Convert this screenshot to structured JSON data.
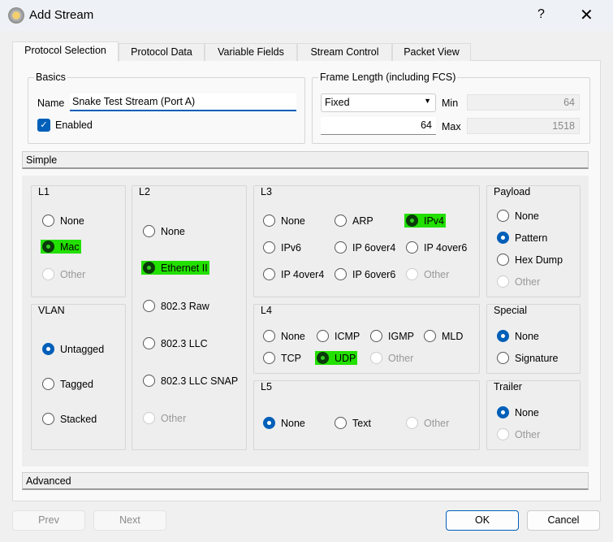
{
  "window": {
    "title": "Add Stream",
    "help": "?",
    "close": "✕"
  },
  "tabs": [
    "Protocol Selection",
    "Protocol Data",
    "Variable Fields",
    "Stream Control",
    "Packet View"
  ],
  "basics": {
    "title": "Basics",
    "name_label": "Name",
    "name_value": "Snake Test Stream (Port A)",
    "enabled_label": "Enabled",
    "enabled": true
  },
  "frame": {
    "title": "Frame Length (including FCS)",
    "mode": "Fixed",
    "value": "64",
    "min_label": "Min",
    "min": "64",
    "max_label": "Max",
    "max": "1518"
  },
  "sections": {
    "simple": "Simple",
    "advanced": "Advanced"
  },
  "groups": [
    {
      "title": "L1",
      "options": [
        {
          "label": "None"
        },
        {
          "label": "Mac",
          "selected": true,
          "highlighted": true
        },
        {
          "label": "Other",
          "disabled": true
        }
      ]
    },
    {
      "title": "VLAN",
      "options": [
        {
          "label": "Untagged",
          "selected": true
        },
        {
          "label": "Tagged"
        },
        {
          "label": "Stacked"
        }
      ]
    },
    {
      "title": "L2",
      "options": [
        {
          "label": "None"
        },
        {
          "label": "Ethernet II",
          "selected": true,
          "highlighted": true
        },
        {
          "label": "802.3 Raw"
        },
        {
          "label": "802.3 LLC"
        },
        {
          "label": "802.3 LLC SNAP"
        },
        {
          "label": "Other",
          "disabled": true
        }
      ]
    },
    {
      "title": "L3",
      "options": [
        {
          "label": "None"
        },
        {
          "label": "ARP"
        },
        {
          "label": "IPv4",
          "selected": true,
          "highlighted": true
        },
        {
          "label": "IPv6"
        },
        {
          "label": "IP 6over4"
        },
        {
          "label": "IP 4over6"
        },
        {
          "label": "IP 4over4"
        },
        {
          "label": "IP 6over6"
        },
        {
          "label": "Other",
          "disabled": true
        }
      ]
    },
    {
      "title": "L4",
      "options": [
        {
          "label": "None"
        },
        {
          "label": "ICMP"
        },
        {
          "label": "IGMP"
        },
        {
          "label": "MLD"
        },
        {
          "label": "TCP"
        },
        {
          "label": "UDP",
          "selected": true,
          "highlighted": true
        },
        {
          "label": "Other",
          "disabled": true
        }
      ]
    },
    {
      "title": "L5",
      "options": [
        {
          "label": "None",
          "selected": true
        },
        {
          "label": "Text"
        },
        {
          "label": "Other",
          "disabled": true
        }
      ]
    },
    {
      "title": "Payload",
      "options": [
        {
          "label": "None"
        },
        {
          "label": "Pattern",
          "selected": true
        },
        {
          "label": "Hex Dump"
        },
        {
          "label": "Other",
          "disabled": true
        }
      ]
    },
    {
      "title": "Special",
      "options": [
        {
          "label": "None",
          "selected": true
        },
        {
          "label": "Signature"
        }
      ]
    },
    {
      "title": "Trailer",
      "options": [
        {
          "label": "None",
          "selected": true
        },
        {
          "label": "Other",
          "disabled": true
        }
      ]
    }
  ],
  "buttons": {
    "prev": "Prev",
    "next": "Next",
    "ok": "OK",
    "cancel": "Cancel"
  }
}
